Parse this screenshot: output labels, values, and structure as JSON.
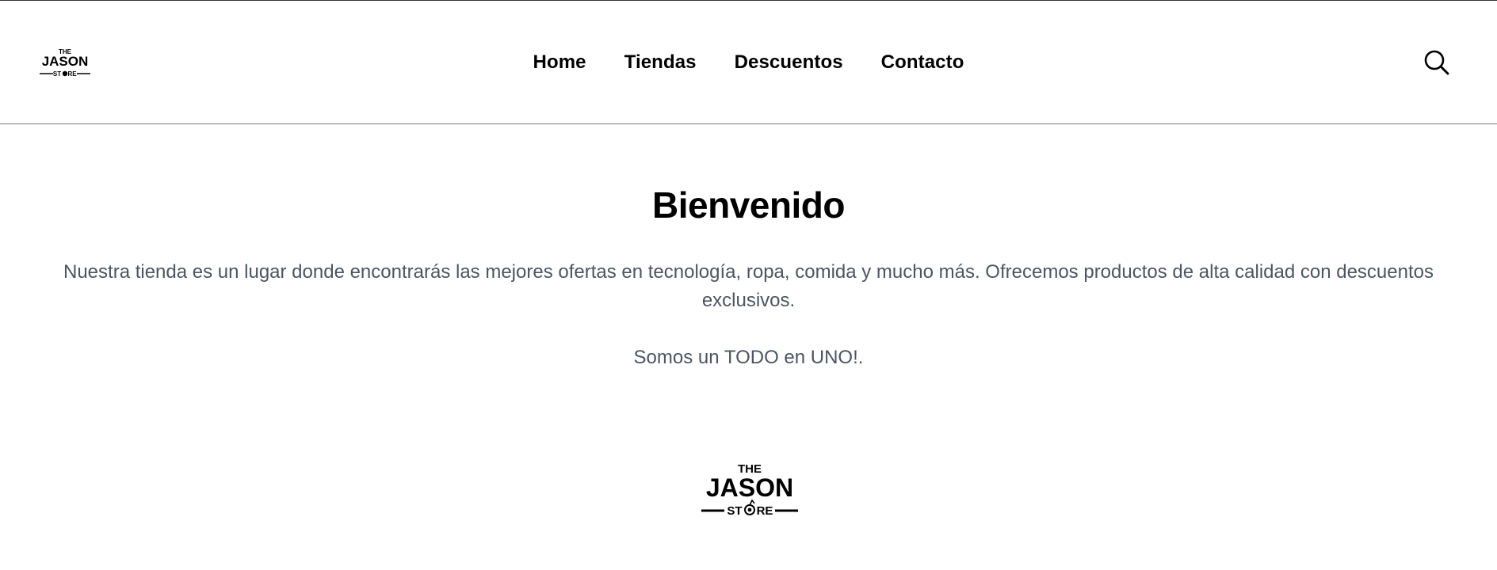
{
  "brand": {
    "logo_line1": "THE",
    "logo_line2": "JASON",
    "logo_line3_left": "ST",
    "logo_line3_right": "RE",
    "logo_alt": "The Jason Store"
  },
  "nav": {
    "items": [
      {
        "label": "Home"
      },
      {
        "label": "Tiendas"
      },
      {
        "label": "Descuentos"
      },
      {
        "label": "Contacto"
      }
    ]
  },
  "search": {
    "icon": "search-icon"
  },
  "main": {
    "title": "Bienvenido",
    "intro": "Nuestra tienda es un lugar donde encontrarás las mejores ofertas en tecnología, ropa, comida y mucho más. Ofrecemos productos de alta calidad con descuentos exclusivos.",
    "tagline": "Somos un TODO en UNO!."
  },
  "colors": {
    "text_primary": "#000000",
    "text_secondary": "#4b5563",
    "divider": "#7a7a7a",
    "background": "#ffffff"
  }
}
